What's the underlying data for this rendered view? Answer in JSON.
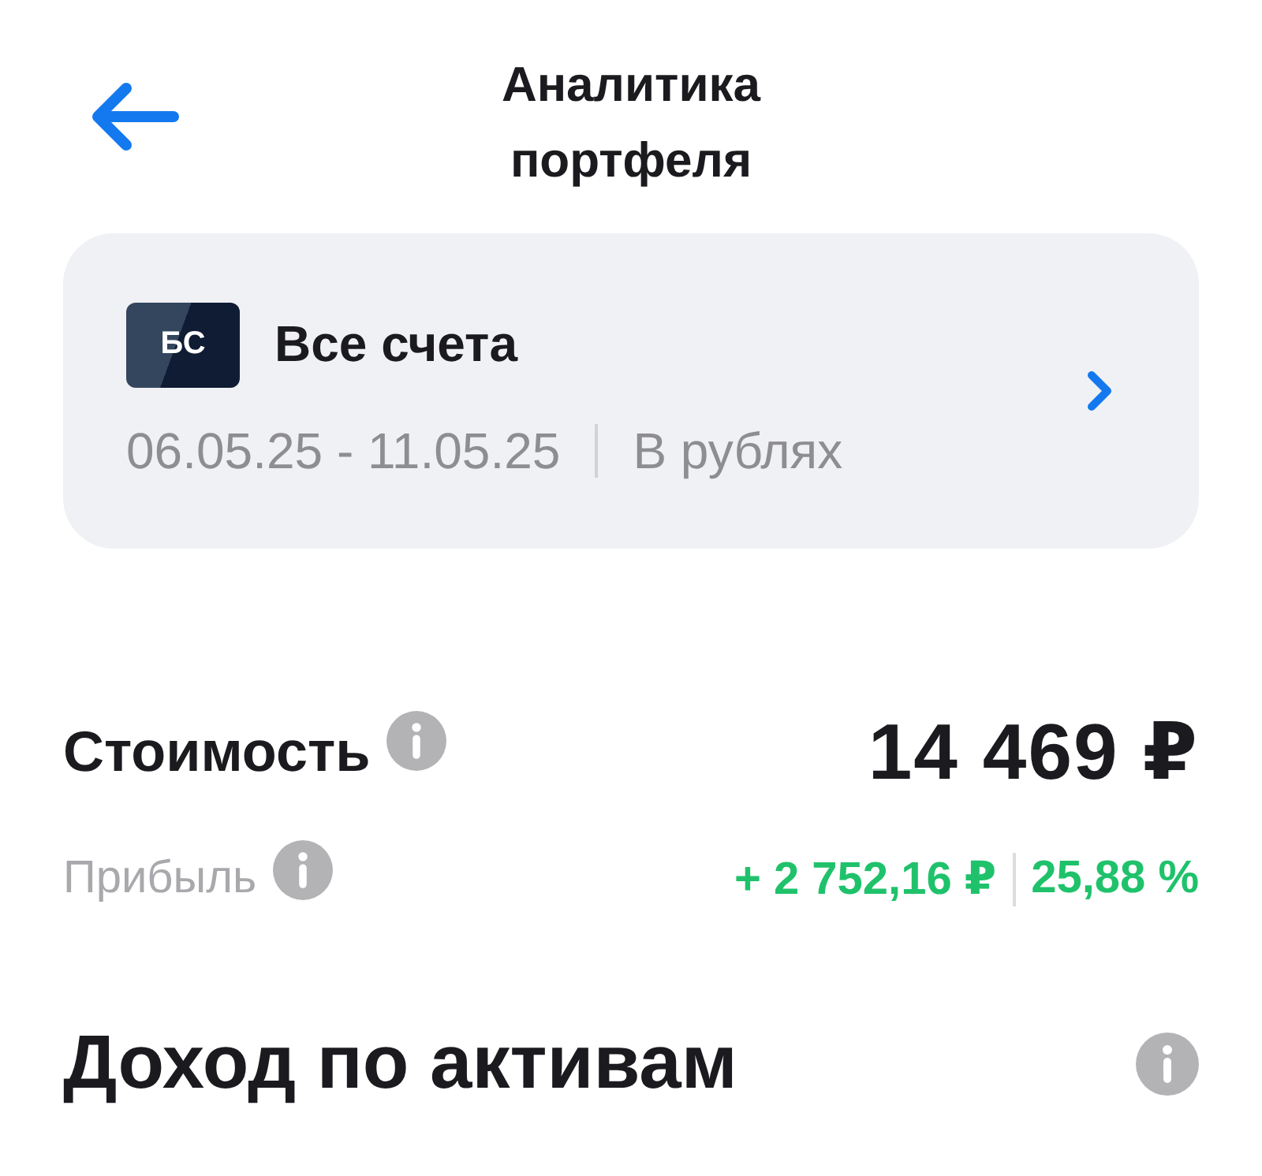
{
  "header": {
    "title": "Аналитика портфеля"
  },
  "account_card": {
    "badge": "БС",
    "name": "Все счета",
    "period": "06.05.25 - 11.05.25",
    "currency": "В рублях"
  },
  "metrics": [
    {
      "kind": "main",
      "label": "Стоимость",
      "value": "14 469 ₽"
    },
    {
      "kind": "profit",
      "label": "Прибыль",
      "value": "+ 2 752,16 ₽",
      "percent": "25,88 %"
    }
  ],
  "section": {
    "title": "Доход по активам"
  }
}
